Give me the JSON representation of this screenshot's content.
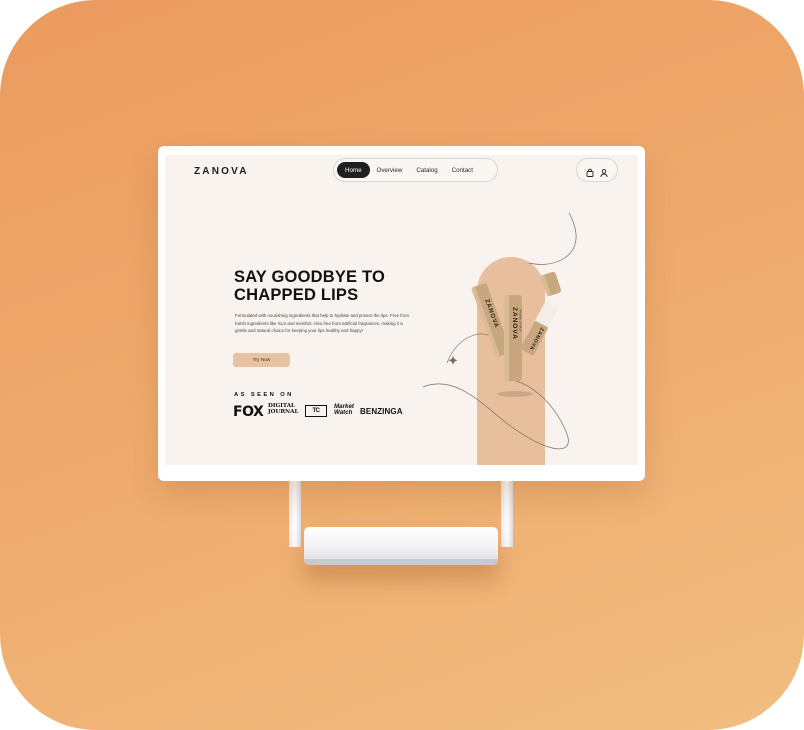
{
  "site": {
    "logo": "ZANOVA",
    "nav": [
      "Home",
      "Overview",
      "Catalog",
      "Contact"
    ],
    "active_nav": "Home",
    "icons": [
      "bag-icon",
      "user-icon"
    ]
  },
  "hero": {
    "headline_line1": "SAY GOODBYE TO",
    "headline_line2": "CHAPPED LIPS",
    "description": "Formulated with nourishing ingredients that help to hydrate and protect the lips. Free from harsh ingredients like SLS and menthol. Also free from artificial fragrances, making it a gentle and natural choice for keeping your lips healthy and happy!",
    "cta_label": "Try Now"
  },
  "press": {
    "label": "AS SEEN ON",
    "brands": {
      "fox": "FOX",
      "digital_journal_1": "DIGITAL",
      "digital_journal_2": "JOURNAL",
      "techcrunch": "TC",
      "marketwatch_1": "Market",
      "marketwatch_2": "Watch",
      "benzinga": "BENZINGA"
    }
  },
  "product": {
    "tube_text_main": "ZANOVA",
    "tube_text_sub": "ORGANIC LIP BALM"
  },
  "colors": {
    "background_top": "#ec9a5f",
    "background_bottom": "#f1bd80",
    "screen_bg": "#f8f3ee",
    "arch": "#e7bf9c",
    "tube": "#c8a67f",
    "cta": "#e8c3a2",
    "nav_active": "#1f1f1f"
  }
}
